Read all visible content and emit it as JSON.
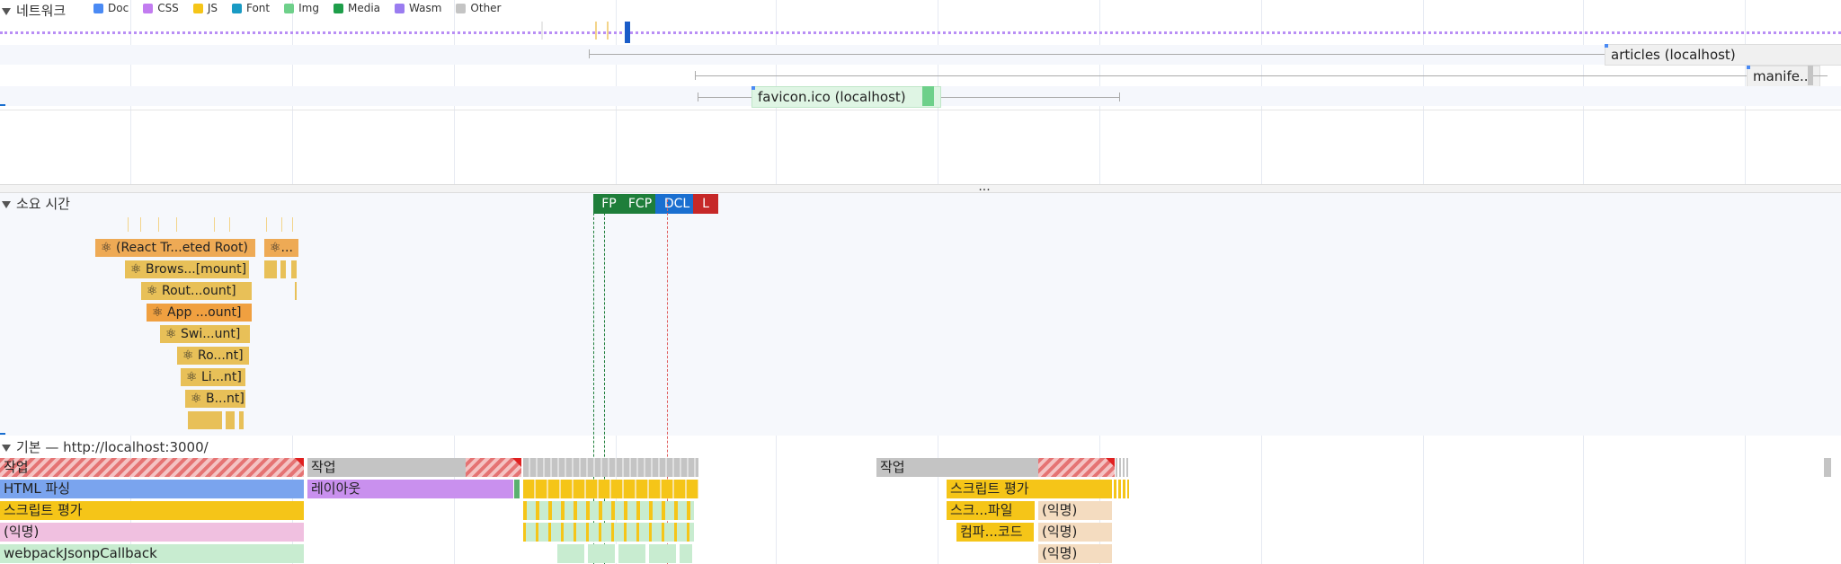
{
  "network": {
    "title": "네트워크",
    "legend": [
      {
        "label": "Doc",
        "color": "#4a8af4"
      },
      {
        "label": "CSS",
        "color": "#c27cf0"
      },
      {
        "label": "JS",
        "color": "#f5c518"
      },
      {
        "label": "Font",
        "color": "#1a9bc4"
      },
      {
        "label": "Img",
        "color": "#6ed08a"
      },
      {
        "label": "Media",
        "color": "#1e9e4a"
      },
      {
        "label": "Wasm",
        "color": "#9a7cf0"
      },
      {
        "label": "Other",
        "color": "#c4c4c4"
      }
    ],
    "requests": [
      {
        "label": "articles (localhost)"
      },
      {
        "label": "manife..."
      },
      {
        "label": "favicon.ico (localhost)"
      }
    ],
    "more": "..."
  },
  "timings": {
    "title": "소요 시간",
    "markers": [
      {
        "label": "FP",
        "color": "#1e7e3a"
      },
      {
        "label": "FCP",
        "color": "#1e7e3a"
      },
      {
        "label": "DCL",
        "color": "#1a6fd0"
      },
      {
        "label": "L",
        "color": "#c62828"
      }
    ],
    "react": [
      "⚛ (React Tr...eted Root)",
      "⚛...",
      "⚛ Brows...[mount]",
      "⚛ Rout...ount]",
      "⚛ App ...ount]",
      "⚛ Swi...unt]",
      "⚛ Ro...nt]",
      "⚛ Li...nt]",
      "⚛ B...nt]"
    ]
  },
  "main": {
    "title": "기본 — http://localhost:3000/",
    "tasks": {
      "task1": "작업",
      "task2": "작업",
      "task3": "작업",
      "html_parse": "HTML 파싱",
      "layout": "레이아웃",
      "script_eval": "스크립트 평가",
      "anon": "(익명)",
      "webpack": "webpackJsonpCallback",
      "script_eval2": "스크립트 평가",
      "script_compile": "스크...파일",
      "anon2": "(익명)",
      "compile_code": "컴파...코드",
      "anon3": "(익명)",
      "anon4": "(익명)"
    }
  }
}
